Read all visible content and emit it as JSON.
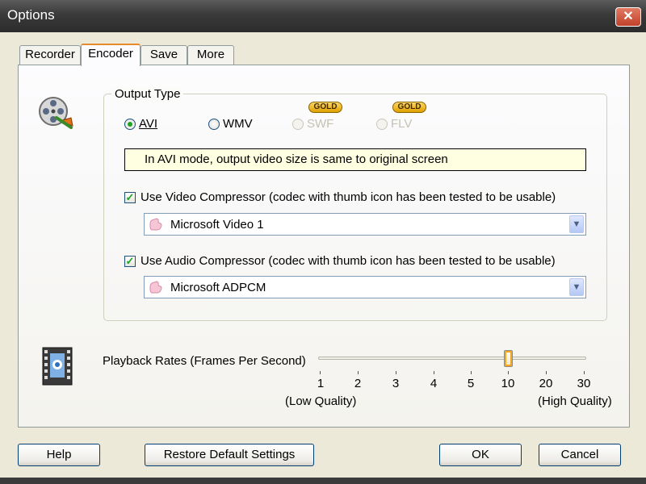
{
  "window": {
    "title": "Options",
    "close_label": "✕"
  },
  "tabs": [
    {
      "label": "Recorder"
    },
    {
      "label": "Encoder",
      "active": true
    },
    {
      "label": "Save"
    },
    {
      "label": "More"
    }
  ],
  "output_type": {
    "group_title": "Output Type",
    "options": [
      {
        "label": "AVI",
        "selected": true,
        "enabled": true
      },
      {
        "label": "WMV",
        "selected": false,
        "enabled": true
      },
      {
        "label": "SWF",
        "selected": false,
        "enabled": false,
        "badge": "GOLD"
      },
      {
        "label": "FLV",
        "selected": false,
        "enabled": false,
        "badge": "GOLD"
      }
    ],
    "info_text": "In AVI mode, output video size is same to original screen"
  },
  "video_compressor": {
    "checked": true,
    "label": "Use Video Compressor  (codec with thumb icon has been tested to be usable)",
    "selected": "Microsoft Video 1"
  },
  "audio_compressor": {
    "checked": true,
    "label": "Use Audio Compressor  (codec with thumb icon has been tested to be usable)",
    "selected": "Microsoft ADPCM"
  },
  "playback": {
    "label": "Playback Rates (Frames Per Second)",
    "ticks": [
      "1",
      "2",
      "3",
      "4",
      "5",
      "10",
      "20",
      "30"
    ],
    "value": "10",
    "low_label": "(Low Quality)",
    "high_label": "(High Quality)"
  },
  "buttons": {
    "help": "Help",
    "restore": "Restore Default Settings",
    "ok": "OK",
    "cancel": "Cancel"
  },
  "colors": {
    "accent_tab": "#e68b2c",
    "radio_dot": "#21a121",
    "info_bg": "#ffffe1"
  }
}
